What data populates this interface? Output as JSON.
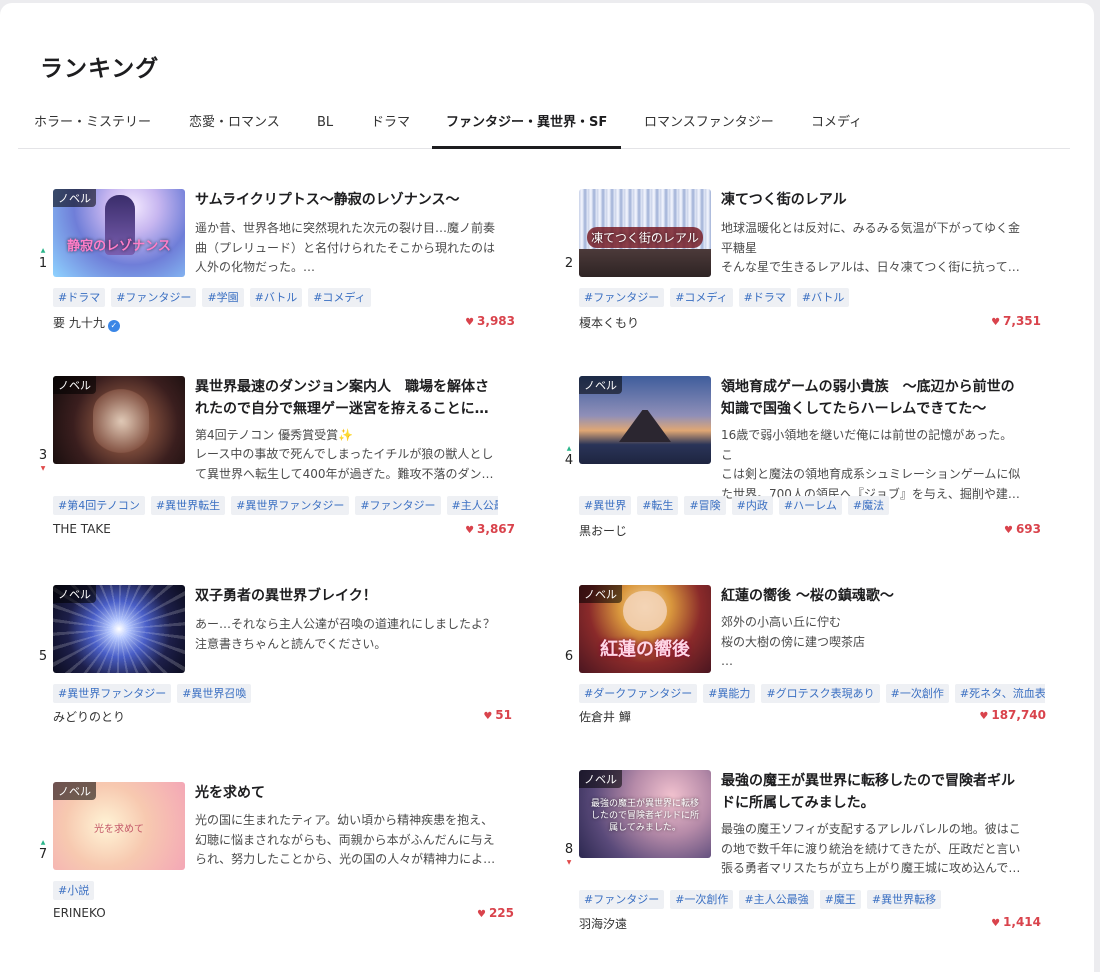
{
  "page": {
    "title": "ランキング"
  },
  "tabs": [
    {
      "label": "ホラー・ミステリー"
    },
    {
      "label": "恋愛・ロマンス"
    },
    {
      "label": "BL"
    },
    {
      "label": "ドラマ"
    },
    {
      "label": "ファンタジー・異世界・SF"
    },
    {
      "label": "ロマンスファンタジー"
    },
    {
      "label": "コメディ"
    }
  ],
  "active_tab": "ファンタジー・異世界・SF",
  "colors": {
    "accent": "#1d1d1f",
    "tag_text": "#3a6fc2",
    "tag_bg": "#eef0f4",
    "likes": "#d9434c",
    "rank_up": "#2bb58a",
    "rank_down": "#e04a4a"
  },
  "works": [
    {
      "rank": "1",
      "trend": "up",
      "novel_label": "ノベル",
      "thumb_text": "静寂のレゾナンス",
      "title": "サムライクリプトス〜静寂のレゾナンス〜",
      "desc": "遥か昔、世界各地に突然現れた次元の裂け目…魔ノ前奏\n曲（プレリュード）と名付けられたそこから現れたのは\n人外の化物だった。…",
      "tags": [
        "#ドラマ",
        "#ファンタジー",
        "#学園",
        "#バトル",
        "#コメディ"
      ],
      "author": "要 九十九",
      "verified": true,
      "likes": "3,983"
    },
    {
      "rank": "2",
      "trend": "",
      "novel_label": "",
      "thumb_text": "凍てつく街のレアル",
      "title": "凍てつく街のレアル",
      "desc": "地球温暖化とは反対に、みるみる気温が下がってゆく金\n平糖星\nそんな星で生きるレアルは、日々凍てつく街に抗って…",
      "tags": [
        "#ファンタジー",
        "#コメディ",
        "#ドラマ",
        "#バトル"
      ],
      "author": "榎本くもり",
      "verified": false,
      "likes": "7,351"
    },
    {
      "rank": "3",
      "trend": "down",
      "novel_label": "ノベル",
      "thumb_text": "",
      "title": "異世界最速のダンジョン案内人　職場を解体さ\nれたので自分で無理ゲー迷宮を拵えることに…",
      "award": "第4回テノコン 優秀賞受賞",
      "desc": "レース中の事故で死んでしまったイチルが狼の獣人とし\nて異世界へ転生して400年が過ぎた。難攻不落のダン…",
      "tags": [
        "#第4回テノコン",
        "#異世界転生",
        "#異世界ファンタジー",
        "#ファンタジー",
        "#主人公最強"
      ],
      "author": "THE TAKE",
      "verified": false,
      "likes": "3,867"
    },
    {
      "rank": "4",
      "trend": "up",
      "novel_label": "ノベル",
      "thumb_text": "",
      "title": "領地育成ゲームの弱小貴族　〜底辺から前世の\n知識で国強くしてたらハーレムできてた〜",
      "desc": "16歳で弱小領地を継いだ俺には前世の記憶があった。こ\nこは剣と魔法の領地育成系シュミレーションゲームに似\nた世界。700人の領民へ『ジョブ』を与え、掘削や建…",
      "tags": [
        "#異世界",
        "#転生",
        "#冒険",
        "#内政",
        "#ハーレム",
        "#魔法"
      ],
      "author": "黒おーじ",
      "verified": false,
      "likes": "693"
    },
    {
      "rank": "5",
      "trend": "",
      "novel_label": "ノベル",
      "thumb_text": "",
      "title": "双子勇者の異世界ブレイク！",
      "desc": "あー…それなら主人公達が召喚の道連れにしましたよ？\n注意書きちゃんと読んでください。",
      "tags": [
        "#異世界ファンタジー",
        "#異世界召喚"
      ],
      "author": "みどりのとり",
      "verified": false,
      "likes": "51"
    },
    {
      "rank": "6",
      "trend": "",
      "novel_label": "ノベル",
      "thumb_text": "紅蓮の嚮後",
      "title": "紅蓮の嚮後 〜桜の鎮魂歌〜",
      "desc": "郊外の小高い丘に佇む\n桜の大樹の傍に建つ喫茶店\n…",
      "tags": [
        "#ダークファンタジー",
        "#異能力",
        "#グロテスク表現あり",
        "#一次創作",
        "#死ネタ、流血表現"
      ],
      "author": "佐倉井 鱓",
      "verified": false,
      "likes": "187,740"
    },
    {
      "rank": "7",
      "trend": "up",
      "novel_label": "ノベル",
      "thumb_text": "光を求めて",
      "title": "光を求めて",
      "desc": "光の国に生まれたティア。幼い頃から精神疾患を抱え、\n幻聴に悩まされながらも、両親から本がふんだんに与え\nられ、努力したことから、光の国の人々が精神力によ…",
      "tags": [
        "#小説"
      ],
      "author": "ERINEKO",
      "verified": false,
      "likes": "225"
    },
    {
      "rank": "8",
      "trend": "down",
      "novel_label": "ノベル",
      "thumb_text": "最強の魔王が異世界に転移したので冒険者ギルドに所属してみました。",
      "title": "最強の魔王が異世界に転移したので冒険者ギル\nドに所属してみました。",
      "desc": "最強の魔王ソフィが支配するアレルバレルの地。彼はこ\nの地で数千年に渡り統治を続けてきたが、圧政だと言い\n張る勇者マリスたちが立ち上がり魔王城に攻め込んで…",
      "tags": [
        "#ファンタジー",
        "#一次創作",
        "#主人公最強",
        "#魔王",
        "#異世界転移"
      ],
      "author": "羽海汐遠",
      "verified": false,
      "likes": "1,414"
    }
  ]
}
